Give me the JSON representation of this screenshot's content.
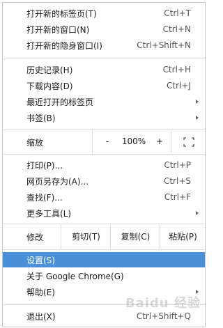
{
  "menu": {
    "group1": [
      {
        "label": "打开新的标签页(T)",
        "shortcut": "Ctrl+T"
      },
      {
        "label": "打开新的窗口(N)",
        "shortcut": "Ctrl+N"
      },
      {
        "label": "打开新的隐身窗口(I)",
        "shortcut": "Ctrl+Shift+N"
      }
    ],
    "group2": [
      {
        "label": "历史记录(H)",
        "shortcut": "Ctrl+H"
      },
      {
        "label": "下载内容(D)",
        "shortcut": "Ctrl+J"
      },
      {
        "label": "最近打开的标签页",
        "shortcut": ""
      },
      {
        "label": "书签(B)",
        "shortcut": ""
      }
    ],
    "zoom": {
      "label": "缩放",
      "minus": "-",
      "level": "100%",
      "plus": "+",
      "fullscreen_icon": "fullscreen-icon"
    },
    "group3": [
      {
        "label": "打印(P)...",
        "shortcut": "Ctrl+P"
      },
      {
        "label": "网页另存为(A)...",
        "shortcut": "Ctrl+S"
      },
      {
        "label": "查找(F)...",
        "shortcut": "Ctrl+F"
      },
      {
        "label": "更多工具(L)",
        "shortcut": ""
      }
    ],
    "edit": {
      "label": "修改",
      "cut": "剪切(T)",
      "copy": "复制(C)",
      "paste": "粘贴(P)"
    },
    "group4": [
      {
        "label": "设置(S)",
        "shortcut": ""
      },
      {
        "label": "关于 Google Chrome(G)",
        "shortcut": ""
      },
      {
        "label": "帮助(E)",
        "shortcut": ""
      }
    ],
    "exit": {
      "label": "退出(X)",
      "shortcut": "Ctrl+Shift+Q"
    }
  },
  "watermark": "Baidu 经验",
  "colors": {
    "highlight": "#4a90d9",
    "divider": "#dedede"
  }
}
